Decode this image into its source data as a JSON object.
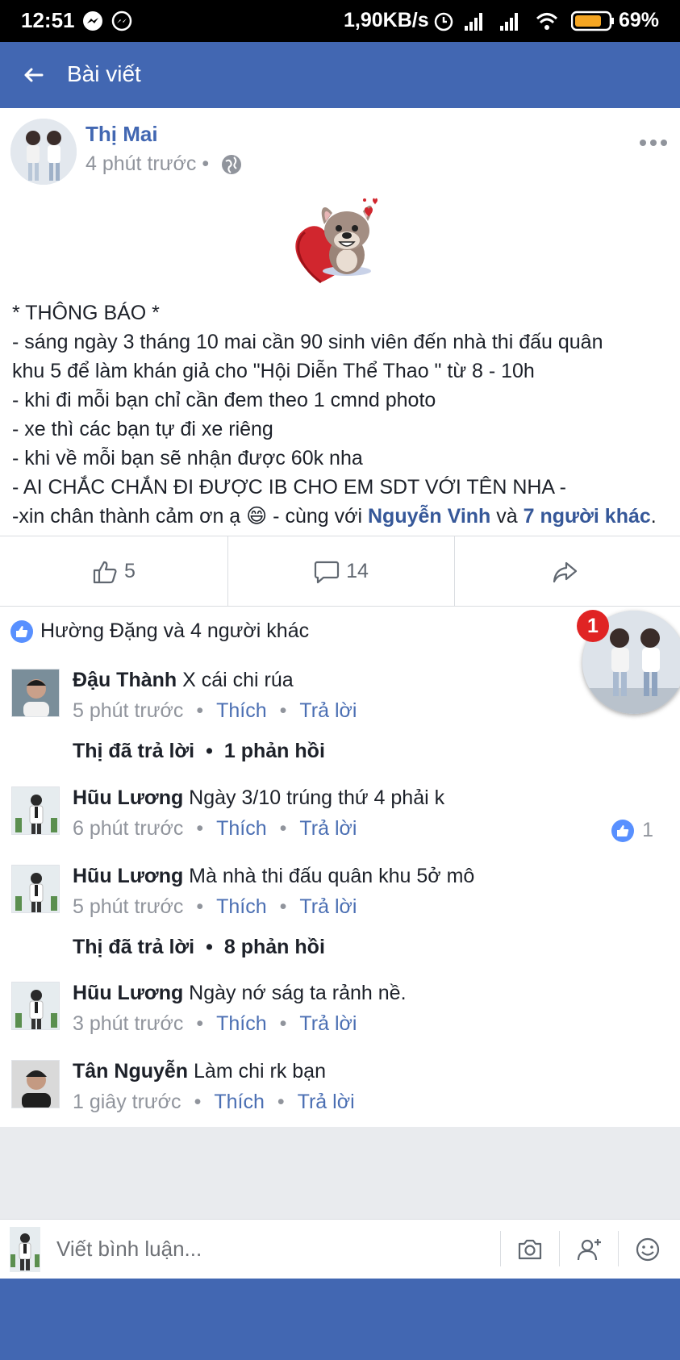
{
  "status_bar": {
    "time": "12:51",
    "network_speed": "1,90KB/s",
    "battery": "69%"
  },
  "header": {
    "title": "Bài viết"
  },
  "post": {
    "author": "Thị Mai",
    "time": "4 phút trước",
    "lines": [
      "* THÔNG BÁO *",
      "- sáng ngày 3 tháng 10 mai cần 90 sinh viên đến nhà thi đấu quân",
      "khu 5 để làm khán giả cho \"Hội Diễn Thể Thao \" từ 8 - 10h",
      "- khi đi mỗi bạn chỉ cần đem theo 1 cmnd photo",
      "- xe thì các bạn tự đi xe riêng",
      "- khi về mỗi bạn sẽ nhận được 60k nha",
      "- AI CHẮC CHẮN ĐI ĐƯỢC IB CHO EM SDT VỚI TÊN NHA -"
    ],
    "last_line": {
      "prefix": "-xin chân thành cảm ơn ạ 😄 - cùng với ",
      "tag1": "Nguyễn Vinh",
      "mid": " và ",
      "tag2": "7 người khác",
      "suffix": "."
    }
  },
  "actions": {
    "likes": "5",
    "comments": "14"
  },
  "likes_summary": "Hường Đặng và 4 người khác",
  "chat_head": {
    "badge": "1"
  },
  "comments": [
    {
      "name": "Đậu Thành",
      "text": " X cái chi rúa",
      "time": "5 phút trước",
      "like": "Thích",
      "reply": "Trả lời",
      "replies": {
        "who": "Thị đã trả lời",
        "count": "1 phản hồi"
      }
    },
    {
      "name": "Hũu Lương",
      "text": " Ngày 3/10 trúng thứ 4 phải k",
      "time": "6 phút trước",
      "like": "Thích",
      "reply": "Trả lời",
      "like_count": "1"
    },
    {
      "name": "Hũu Lương",
      "text": " Mà nhà thi đấu quân khu 5ở mô",
      "time": "5 phút trước",
      "like": "Thích",
      "reply": "Trả lời",
      "replies": {
        "who": "Thị đã trả lời",
        "count": "8 phản hồi"
      }
    },
    {
      "name": "Hũu Lương",
      "text": " Ngày nớ ság ta rảnh nề.",
      "time": "3 phút trước",
      "like": "Thích",
      "reply": "Trả lời"
    },
    {
      "name": "Tân Nguyễn",
      "text": " Làm chi rk bạn",
      "time": "1 giây trước",
      "like": "Thích",
      "reply": "Trả lời"
    }
  ],
  "composer": {
    "placeholder": "Viết bình luận..."
  },
  "colors": {
    "brand_blue": "#4267b2",
    "link_blue": "#365899",
    "badge_red": "#e02424"
  }
}
